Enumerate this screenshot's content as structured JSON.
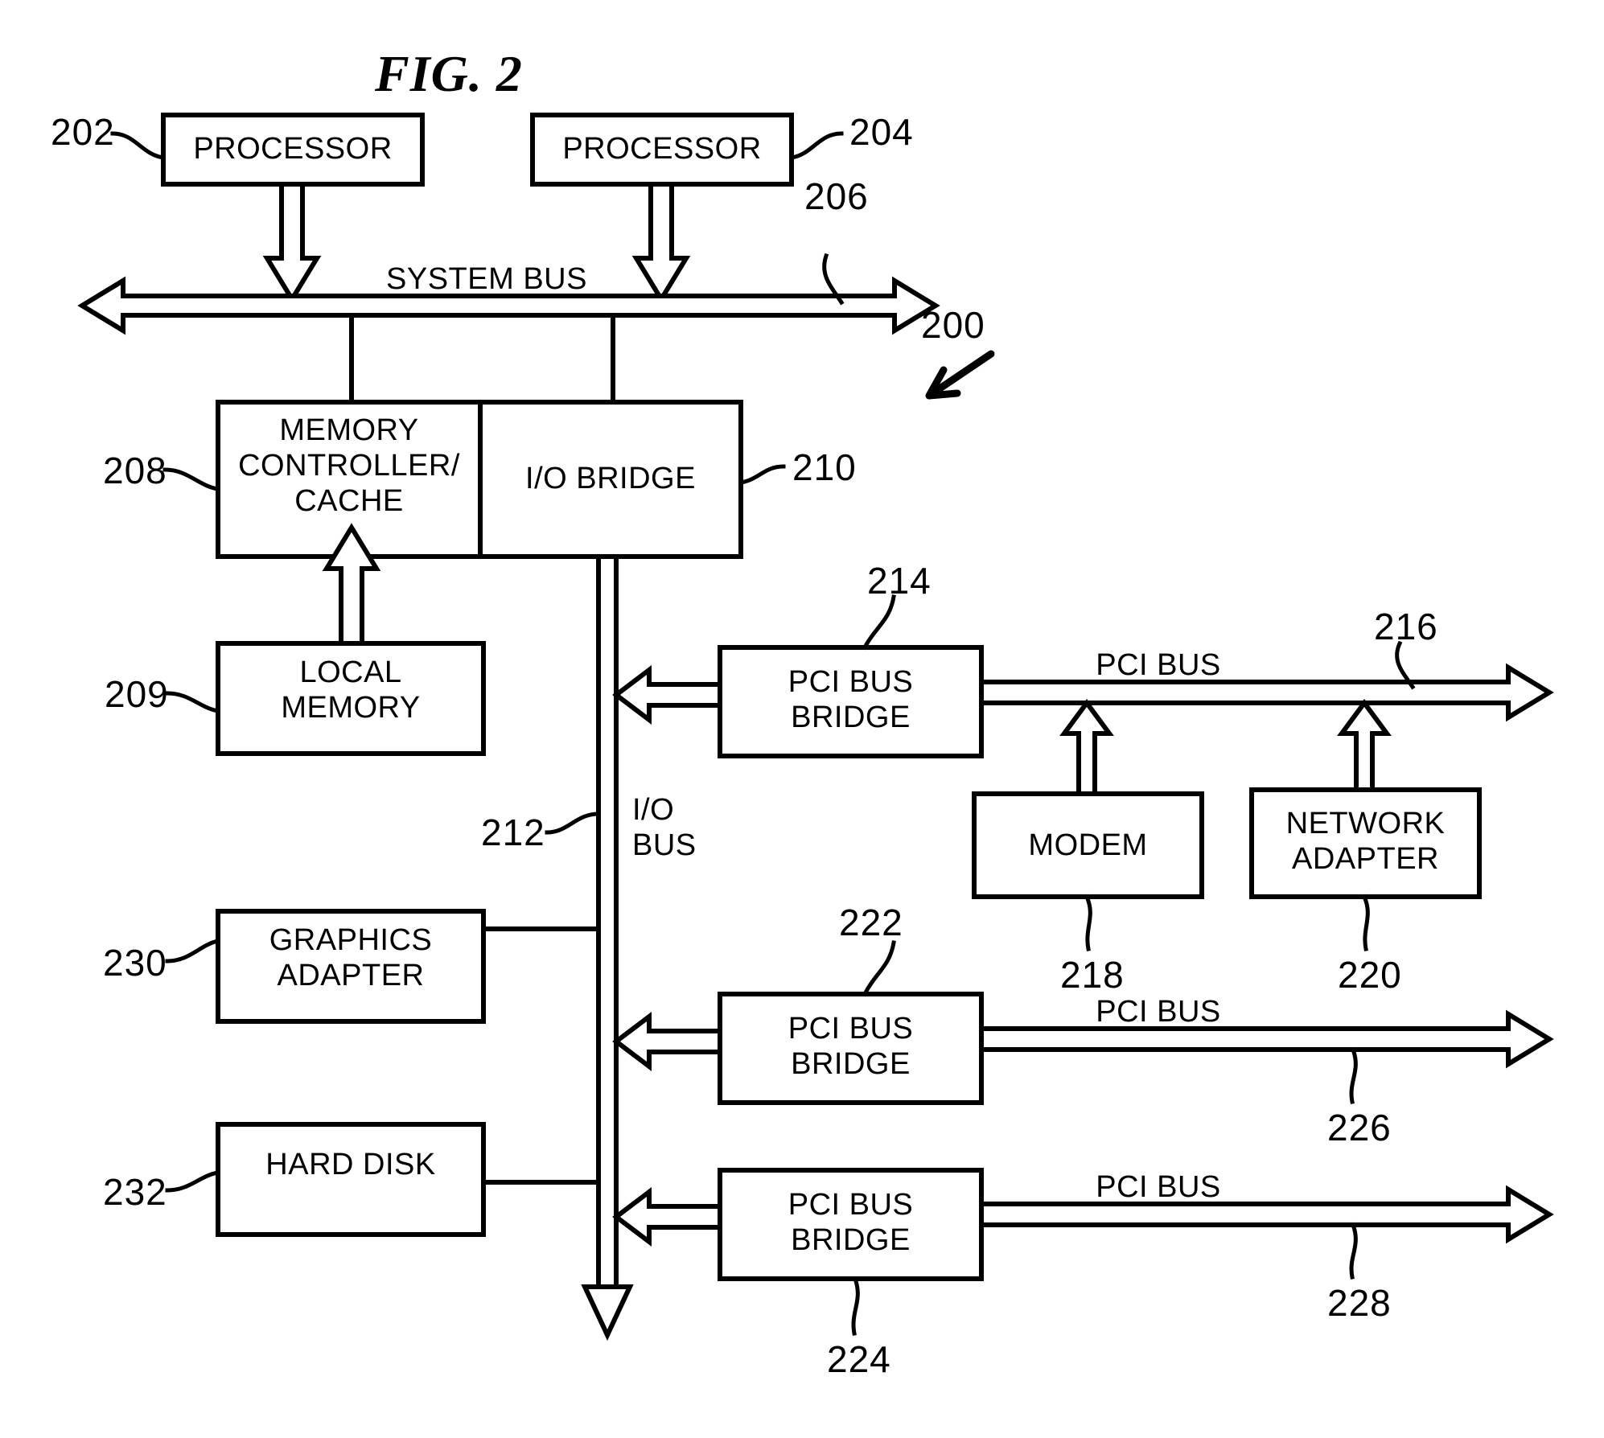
{
  "figure": {
    "title": "FIG. 2",
    "system_ref": "200"
  },
  "colors": {
    "line": "#000000",
    "background": "#ffffff",
    "text": "#000000"
  },
  "blocks": [
    {
      "id": "processor-1",
      "label": "PROCESSOR",
      "ref": "202"
    },
    {
      "id": "processor-2",
      "label": "PROCESSOR",
      "ref": "204"
    },
    {
      "id": "memory-controller",
      "label": "MEMORY\nCONTROLLER/\nCACHE",
      "ref": "208"
    },
    {
      "id": "io-bridge",
      "label": "I/O BRIDGE",
      "ref": "210"
    },
    {
      "id": "local-memory",
      "label": "LOCAL\nMEMORY",
      "ref": "209"
    },
    {
      "id": "pci-bus-bridge-1",
      "label": "PCI BUS\nBRIDGE",
      "ref": "214"
    },
    {
      "id": "modem",
      "label": "MODEM",
      "ref": "218"
    },
    {
      "id": "network-adapter",
      "label": "NETWORK\nADAPTER",
      "ref": "220"
    },
    {
      "id": "graphics-adapter",
      "label": "GRAPHICS\nADAPTER",
      "ref": "230"
    },
    {
      "id": "hard-disk",
      "label": "HARD DISK",
      "ref": "232"
    },
    {
      "id": "pci-bus-bridge-2",
      "label": "PCI BUS\nBRIDGE",
      "ref": "222"
    },
    {
      "id": "pci-bus-bridge-3",
      "label": "PCI BUS\nBRIDGE",
      "ref": "224"
    }
  ],
  "buses": [
    {
      "id": "system-bus",
      "label": "SYSTEM BUS",
      "ref": "206"
    },
    {
      "id": "io-bus",
      "label": "I/O\nBUS",
      "ref": "212"
    },
    {
      "id": "pci-bus-1",
      "label": "PCI BUS",
      "ref": "216"
    },
    {
      "id": "pci-bus-2",
      "label": "PCI BUS",
      "ref": "226"
    },
    {
      "id": "pci-bus-3",
      "label": "PCI BUS",
      "ref": "228"
    }
  ],
  "labels": {
    "title": "FIG. 2",
    "processor_1": "PROCESSOR",
    "processor_2": "PROCESSOR",
    "system_bus": "SYSTEM BUS",
    "memory_controller_l1": "MEMORY",
    "memory_controller_l2": "CONTROLLER/",
    "memory_controller_l3": "CACHE",
    "io_bridge": "I/O BRIDGE",
    "local_memory_l1": "LOCAL",
    "local_memory_l2": "MEMORY",
    "pci_bus_bridge_l1": "PCI BUS",
    "pci_bus_bridge_l2": "BRIDGE",
    "modem": "MODEM",
    "network_adapter_l1": "NETWORK",
    "network_adapter_l2": "ADAPTER",
    "graphics_adapter_l1": "GRAPHICS",
    "graphics_adapter_l2": "ADAPTER",
    "hard_disk": "HARD DISK",
    "io_bus_l1": "I/O",
    "io_bus_l2": "BUS",
    "pci_bus": "PCI BUS"
  },
  "refs": {
    "r200": "200",
    "r202": "202",
    "r204": "204",
    "r206": "206",
    "r208": "208",
    "r209": "209",
    "r210": "210",
    "r212": "212",
    "r214": "214",
    "r216": "216",
    "r218": "218",
    "r220": "220",
    "r222": "222",
    "r224": "224",
    "r226": "226",
    "r228": "228",
    "r230": "230",
    "r232": "232"
  }
}
